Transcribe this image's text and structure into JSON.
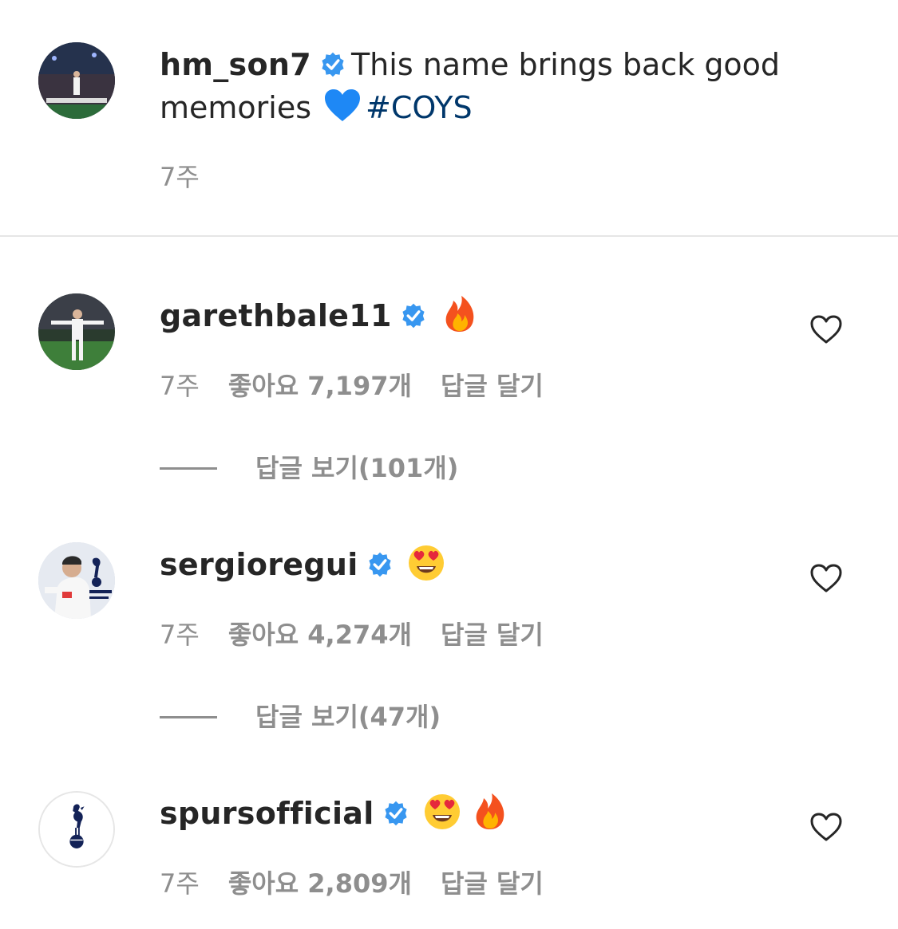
{
  "post": {
    "username": "hm_son7",
    "caption_line1": "This name brings back good",
    "caption_line2": "memories",
    "hashtag": "#COYS",
    "time": "7주"
  },
  "comments": [
    {
      "username": "garethbale11",
      "emojis": [
        "fire-emoji"
      ],
      "time": "7주",
      "likes": "좋아요 7,197개",
      "reply": "답글 달기",
      "view_replies": "답글 보기(101개)"
    },
    {
      "username": "sergioregui",
      "emojis": [
        "heart-eyes-emoji"
      ],
      "time": "7주",
      "likes": "좋아요 4,274개",
      "reply": "답글 달기",
      "view_replies": "답글 보기(47개)"
    },
    {
      "username": "spursofficial",
      "emojis": [
        "heart-eyes-emoji",
        "fire-emoji"
      ],
      "time": "7주",
      "likes": "좋아요 2,809개",
      "reply": "답글 달기"
    }
  ],
  "colors": {
    "text": "#262626",
    "secondary": "#8e8e8e",
    "hashtag": "#00376b",
    "verified": "#3897f0"
  },
  "icons": {
    "verified": "verified-badge-icon",
    "heart": "heart-outline-icon",
    "blue_heart": "blue-heart-emoji"
  }
}
